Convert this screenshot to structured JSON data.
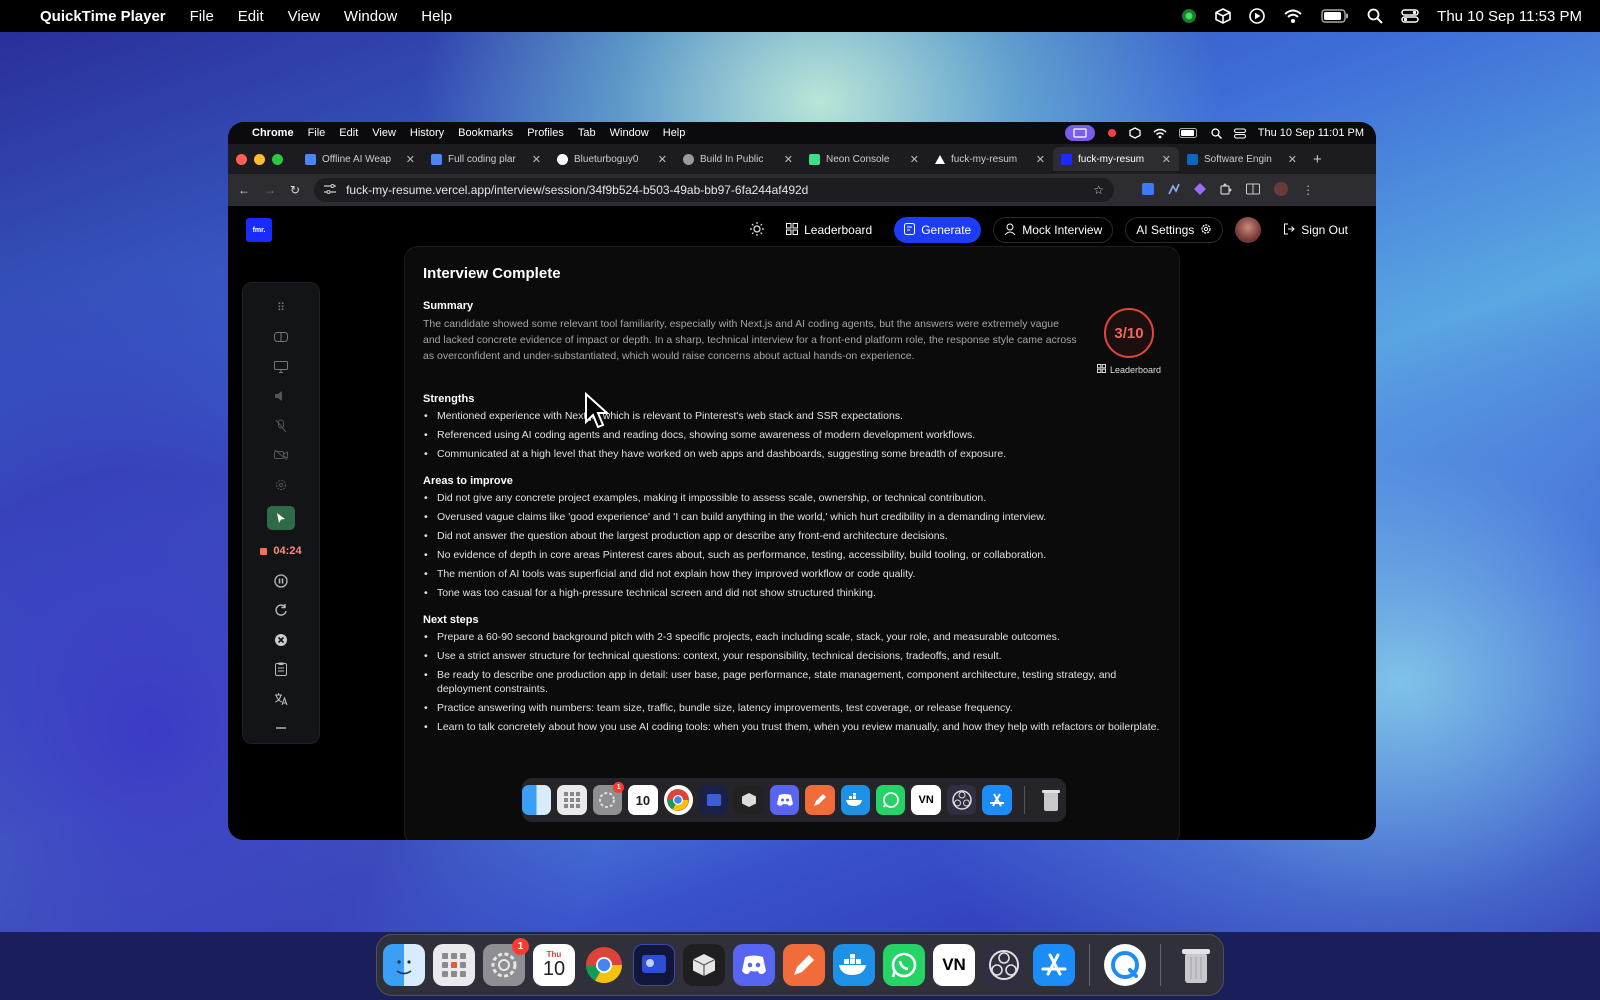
{
  "outer_menubar": {
    "app_name": "QuickTime Player",
    "menus": [
      "File",
      "Edit",
      "View",
      "Window",
      "Help"
    ],
    "clock": "Thu 10 Sep  11:53 PM"
  },
  "inner_menubar": {
    "app_name": "Chrome",
    "menus": [
      "File",
      "Edit",
      "View",
      "History",
      "Bookmarks",
      "Profiles",
      "Tab",
      "Window",
      "Help"
    ],
    "clock": "Thu 10 Sep  11:01 PM"
  },
  "tabs": [
    {
      "title": "Offline AI Weap",
      "color": "#4a86f5",
      "active": false
    },
    {
      "title": "Full coding plar",
      "color": "#4a86f5",
      "active": false
    },
    {
      "title": "Blueturboguy0",
      "color": "#ffffff",
      "active": false
    },
    {
      "title": "Build In Public",
      "color": "#9a9a9a",
      "active": false
    },
    {
      "title": "Neon Console",
      "color": "#37e08a",
      "active": false
    },
    {
      "title": "fuck-my-resum",
      "color": "#ffffff",
      "active": false
    },
    {
      "title": "fuck-my-resum",
      "color": "#1a2bff",
      "active": true
    },
    {
      "title": "Software Engin",
      "color": "#0a66c2",
      "active": false
    }
  ],
  "address_bar": {
    "url": "fuck-my-resume.vercel.app/interview/session/34f9b524-b503-49ab-bb97-6fa244af492d"
  },
  "nav": {
    "logo": "fmr.",
    "leaderboard": "Leaderboard",
    "generate": "Generate",
    "mock_interview": "Mock Interview",
    "ai_settings": "AI Settings",
    "sign_out": "Sign Out"
  },
  "recorder": {
    "timer": "04:24"
  },
  "interview": {
    "title": "Interview Complete",
    "summary_heading": "Summary",
    "summary": "The candidate showed some relevant tool familiarity, especially with Next.js and AI coding agents, but the answers were extremely vague and lacked concrete evidence of impact or depth. In a sharp, technical interview for a front-end platform role, the response style came across as overconfident and under-substantiated, which would raise concerns about actual hands-on experience.",
    "score": "3/10",
    "score_link": "Leaderboard",
    "strengths_heading": "Strengths",
    "strengths": [
      "Mentioned experience with Next.js, which is relevant to Pinterest's web stack and SSR expectations.",
      "Referenced using AI coding agents and reading docs, showing some awareness of modern development workflows.",
      "Communicated at a high level that they have worked on web apps and dashboards, suggesting some breadth of exposure."
    ],
    "improve_heading": "Areas to improve",
    "improve": [
      "Did not give any concrete project examples, making it impossible to assess scale, ownership, or technical contribution.",
      "Overused vague claims like 'good experience' and 'I can build anything in the world,' which hurt credibility in a demanding interview.",
      "Did not answer the question about the largest production app or describe any front-end architecture decisions.",
      "No evidence of depth in core areas Pinterest cares about, such as performance, testing, accessibility, build tooling, or collaboration.",
      "The mention of AI tools was superficial and did not explain how they improved workflow or code quality.",
      "Tone was too casual for a high-pressure technical screen and did not show structured thinking."
    ],
    "next_heading": "Next steps",
    "next": [
      "Prepare a 60-90 second background pitch with 2-3 specific projects, each including scale, stack, your role, and measurable outcomes.",
      "Use a strict answer structure for technical questions: context, your responsibility, technical decisions, tradeoffs, and result.",
      "Be ready to describe one production app in detail: user base, page performance, state management, component architecture, testing strategy, and deployment constraints.",
      "Practice answering with numbers: team size, traffic, bundle size, latency improvements, test coverage, or release frequency.",
      "Learn to talk concretely about how you use AI coding tools: when you trust them, when you review manually, and how they help with refactors or boilerplate."
    ]
  },
  "inner_dock": {
    "calendar_day": "10",
    "vn_label": "VN",
    "badge": "1"
  },
  "dock": {
    "calendar_month": "Thu",
    "calendar_day": "10",
    "vn_label": "VN",
    "badge": "1"
  }
}
